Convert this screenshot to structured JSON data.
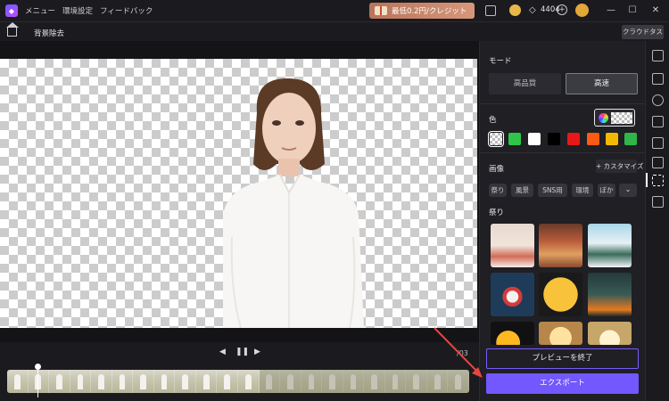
{
  "titlebar": {
    "menu_label": "メニュー",
    "env_settings_label": "環境設定",
    "feedback_label": "フィードバック",
    "promo_text": "最低0.2円/クレジット",
    "credits_count": "4404"
  },
  "toolbar": {
    "page_title": "背景除去",
    "cloud_task_label": "クラウドタスク"
  },
  "playback": {
    "timecode": "/03"
  },
  "panel": {
    "mode_title": "モード",
    "mode_high_quality": "高品質",
    "mode_fast": "高速",
    "color_title": "色",
    "colors": [
      "#2fc548",
      "#ffffff",
      "#000000",
      "#e81818",
      "#ff5a14",
      "#f5b800",
      "#2fb548"
    ],
    "image_title": "画像",
    "customize_label": "カスタマイズ",
    "chips": [
      "祭り",
      "風景",
      "SNS用",
      "環境",
      "ぼか"
    ],
    "category_title": "祭り",
    "exit_preview_label": "プレビューを終了",
    "export_label": "エクスポート"
  }
}
